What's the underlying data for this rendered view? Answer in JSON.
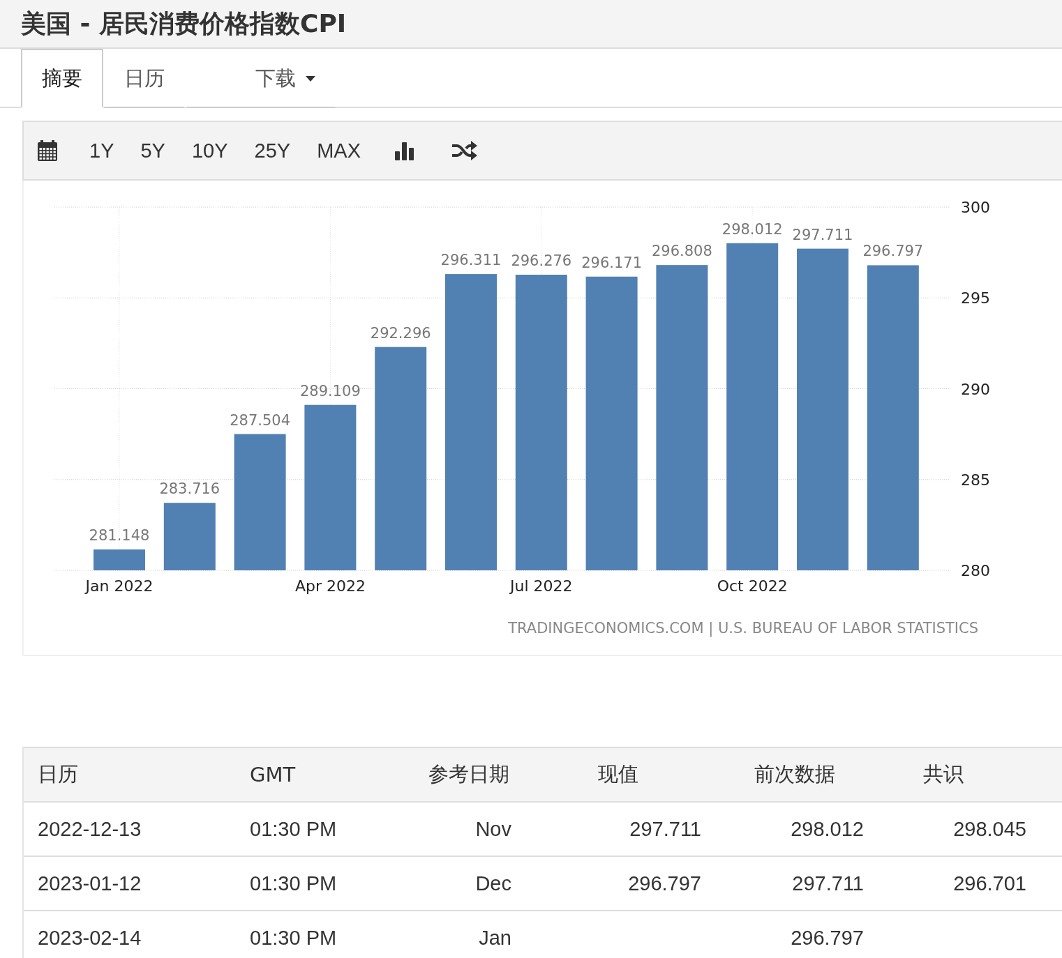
{
  "title": "美国 - 居民消费价格指数CPI",
  "tabs": [
    {
      "label": "摘要",
      "selected": true
    },
    {
      "label": "日历",
      "selected": false
    },
    {
      "label": "下载",
      "selected": false,
      "dropdown": true
    }
  ],
  "toolbar": [
    {
      "kind": "calendar"
    },
    {
      "kind": "text",
      "label": "1Y"
    },
    {
      "kind": "text",
      "label": "5Y"
    },
    {
      "kind": "text",
      "label": "10Y"
    },
    {
      "kind": "text",
      "label": "25Y"
    },
    {
      "kind": "text",
      "label": "MAX"
    },
    {
      "kind": "bars"
    },
    {
      "kind": "shuffle"
    }
  ],
  "chart": {
    "chart_data": {
      "type": "bar",
      "categories": [
        "Jan 2022",
        null,
        null,
        "Apr 2022",
        null,
        null,
        "Jul 2022",
        null,
        null,
        "Oct 2022",
        null,
        null
      ],
      "grid": true,
      "values": [
        281.148,
        283.716,
        287.504,
        289.109,
        292.296,
        296.311,
        296.276,
        296.171,
        296.808,
        298.012,
        297.711,
        296.797
      ],
      "value_labels": [
        "281.148",
        "283.716",
        "287.504",
        "289.109",
        "292.296",
        "296.311",
        "296.276",
        "296.171",
        "296.808",
        "298.012",
        "297.711",
        "296.797"
      ],
      "ylim": [
        280,
        300
      ],
      "yticks": [
        280,
        285,
        290,
        295,
        300
      ],
      "data_labels": true
    },
    "source": "TRADINGECONOMICS.COM | U.S. BUREAU OF LABOR STATISTICS"
  },
  "table": {
    "columns": [
      "日历",
      "GMT",
      "参考日期",
      "现值",
      "前次数据",
      "共识"
    ],
    "rows": [
      {
        "date": "2022-12-13",
        "gmt": "01:30 PM",
        "reference": "Nov",
        "actual": "297.711",
        "previous": "298.012",
        "consensus": "298.045"
      },
      {
        "date": "2023-01-12",
        "gmt": "01:30 PM",
        "reference": "Dec",
        "actual": "296.797",
        "previous": "297.711",
        "consensus": "296.701"
      },
      {
        "date": "2023-02-14",
        "gmt": "01:30 PM",
        "reference": "Jan",
        "previous": "296.797"
      }
    ]
  }
}
